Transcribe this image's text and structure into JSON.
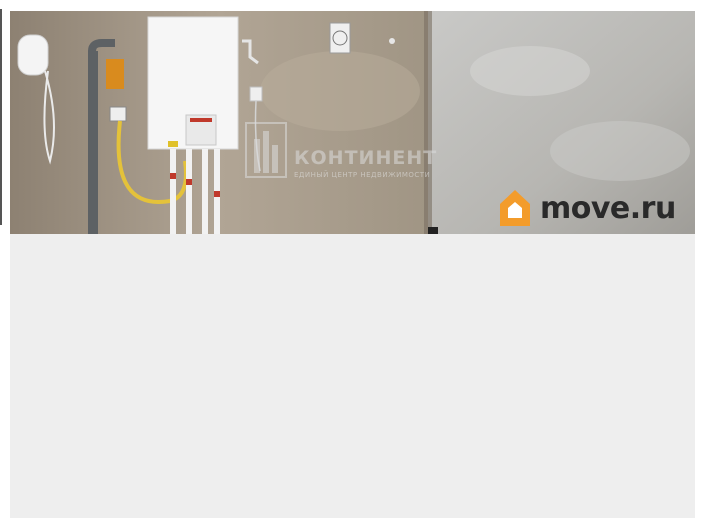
{
  "listing": {
    "photo_alt": "",
    "watermark": {
      "company": "КОНТИНЕНТ",
      "tagline": "ЕДИНЫЙ ЦЕНТР НЕДВИЖИМОСТИ"
    },
    "brand": {
      "name": "move.ru",
      "accent_color": "#f39c2b"
    }
  },
  "colors": {
    "placeholder_bg": "#eeeeee",
    "wall": "#a59886",
    "boiler": "#f2f2f2"
  }
}
